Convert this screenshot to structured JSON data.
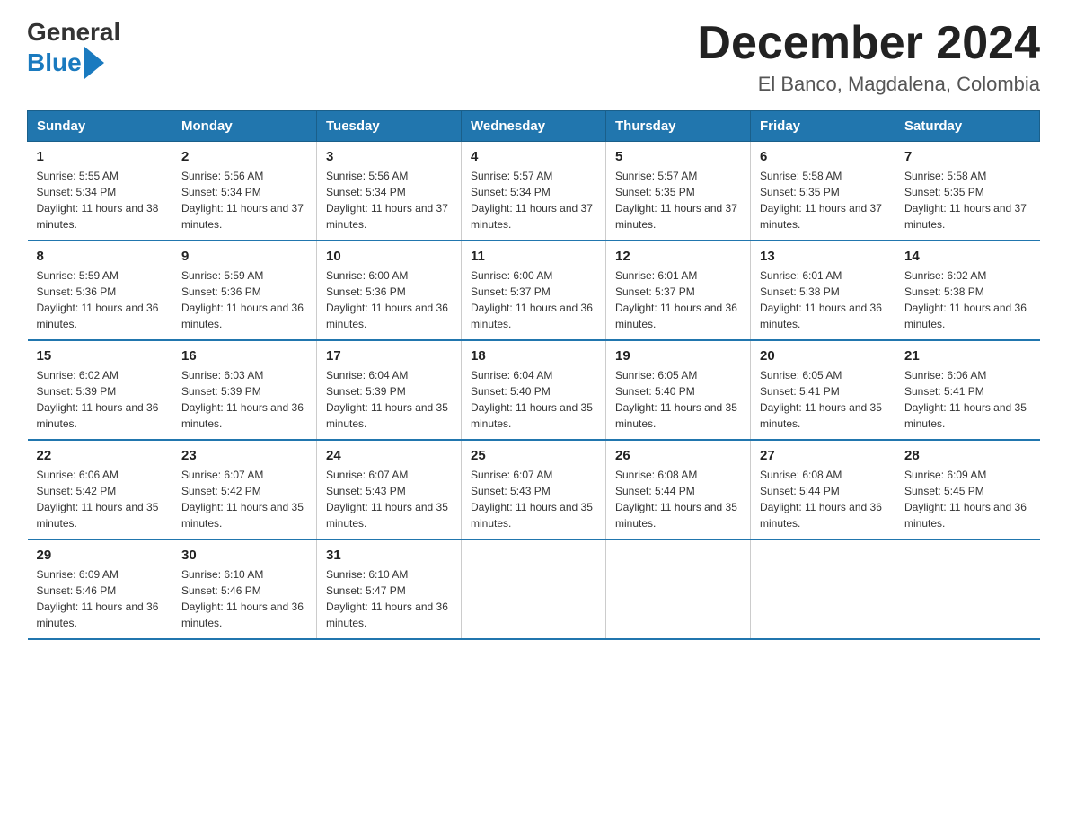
{
  "logo": {
    "general": "General",
    "blue": "Blue"
  },
  "header": {
    "month": "December 2024",
    "location": "El Banco, Magdalena, Colombia"
  },
  "days_header": [
    "Sunday",
    "Monday",
    "Tuesday",
    "Wednesday",
    "Thursday",
    "Friday",
    "Saturday"
  ],
  "weeks": [
    [
      {
        "day": "1",
        "sunrise": "Sunrise: 5:55 AM",
        "sunset": "Sunset: 5:34 PM",
        "daylight": "Daylight: 11 hours and 38 minutes."
      },
      {
        "day": "2",
        "sunrise": "Sunrise: 5:56 AM",
        "sunset": "Sunset: 5:34 PM",
        "daylight": "Daylight: 11 hours and 37 minutes."
      },
      {
        "day": "3",
        "sunrise": "Sunrise: 5:56 AM",
        "sunset": "Sunset: 5:34 PM",
        "daylight": "Daylight: 11 hours and 37 minutes."
      },
      {
        "day": "4",
        "sunrise": "Sunrise: 5:57 AM",
        "sunset": "Sunset: 5:34 PM",
        "daylight": "Daylight: 11 hours and 37 minutes."
      },
      {
        "day": "5",
        "sunrise": "Sunrise: 5:57 AM",
        "sunset": "Sunset: 5:35 PM",
        "daylight": "Daylight: 11 hours and 37 minutes."
      },
      {
        "day": "6",
        "sunrise": "Sunrise: 5:58 AM",
        "sunset": "Sunset: 5:35 PM",
        "daylight": "Daylight: 11 hours and 37 minutes."
      },
      {
        "day": "7",
        "sunrise": "Sunrise: 5:58 AM",
        "sunset": "Sunset: 5:35 PM",
        "daylight": "Daylight: 11 hours and 37 minutes."
      }
    ],
    [
      {
        "day": "8",
        "sunrise": "Sunrise: 5:59 AM",
        "sunset": "Sunset: 5:36 PM",
        "daylight": "Daylight: 11 hours and 36 minutes."
      },
      {
        "day": "9",
        "sunrise": "Sunrise: 5:59 AM",
        "sunset": "Sunset: 5:36 PM",
        "daylight": "Daylight: 11 hours and 36 minutes."
      },
      {
        "day": "10",
        "sunrise": "Sunrise: 6:00 AM",
        "sunset": "Sunset: 5:36 PM",
        "daylight": "Daylight: 11 hours and 36 minutes."
      },
      {
        "day": "11",
        "sunrise": "Sunrise: 6:00 AM",
        "sunset": "Sunset: 5:37 PM",
        "daylight": "Daylight: 11 hours and 36 minutes."
      },
      {
        "day": "12",
        "sunrise": "Sunrise: 6:01 AM",
        "sunset": "Sunset: 5:37 PM",
        "daylight": "Daylight: 11 hours and 36 minutes."
      },
      {
        "day": "13",
        "sunrise": "Sunrise: 6:01 AM",
        "sunset": "Sunset: 5:38 PM",
        "daylight": "Daylight: 11 hours and 36 minutes."
      },
      {
        "day": "14",
        "sunrise": "Sunrise: 6:02 AM",
        "sunset": "Sunset: 5:38 PM",
        "daylight": "Daylight: 11 hours and 36 minutes."
      }
    ],
    [
      {
        "day": "15",
        "sunrise": "Sunrise: 6:02 AM",
        "sunset": "Sunset: 5:39 PM",
        "daylight": "Daylight: 11 hours and 36 minutes."
      },
      {
        "day": "16",
        "sunrise": "Sunrise: 6:03 AM",
        "sunset": "Sunset: 5:39 PM",
        "daylight": "Daylight: 11 hours and 36 minutes."
      },
      {
        "day": "17",
        "sunrise": "Sunrise: 6:04 AM",
        "sunset": "Sunset: 5:39 PM",
        "daylight": "Daylight: 11 hours and 35 minutes."
      },
      {
        "day": "18",
        "sunrise": "Sunrise: 6:04 AM",
        "sunset": "Sunset: 5:40 PM",
        "daylight": "Daylight: 11 hours and 35 minutes."
      },
      {
        "day": "19",
        "sunrise": "Sunrise: 6:05 AM",
        "sunset": "Sunset: 5:40 PM",
        "daylight": "Daylight: 11 hours and 35 minutes."
      },
      {
        "day": "20",
        "sunrise": "Sunrise: 6:05 AM",
        "sunset": "Sunset: 5:41 PM",
        "daylight": "Daylight: 11 hours and 35 minutes."
      },
      {
        "day": "21",
        "sunrise": "Sunrise: 6:06 AM",
        "sunset": "Sunset: 5:41 PM",
        "daylight": "Daylight: 11 hours and 35 minutes."
      }
    ],
    [
      {
        "day": "22",
        "sunrise": "Sunrise: 6:06 AM",
        "sunset": "Sunset: 5:42 PM",
        "daylight": "Daylight: 11 hours and 35 minutes."
      },
      {
        "day": "23",
        "sunrise": "Sunrise: 6:07 AM",
        "sunset": "Sunset: 5:42 PM",
        "daylight": "Daylight: 11 hours and 35 minutes."
      },
      {
        "day": "24",
        "sunrise": "Sunrise: 6:07 AM",
        "sunset": "Sunset: 5:43 PM",
        "daylight": "Daylight: 11 hours and 35 minutes."
      },
      {
        "day": "25",
        "sunrise": "Sunrise: 6:07 AM",
        "sunset": "Sunset: 5:43 PM",
        "daylight": "Daylight: 11 hours and 35 minutes."
      },
      {
        "day": "26",
        "sunrise": "Sunrise: 6:08 AM",
        "sunset": "Sunset: 5:44 PM",
        "daylight": "Daylight: 11 hours and 35 minutes."
      },
      {
        "day": "27",
        "sunrise": "Sunrise: 6:08 AM",
        "sunset": "Sunset: 5:44 PM",
        "daylight": "Daylight: 11 hours and 36 minutes."
      },
      {
        "day": "28",
        "sunrise": "Sunrise: 6:09 AM",
        "sunset": "Sunset: 5:45 PM",
        "daylight": "Daylight: 11 hours and 36 minutes."
      }
    ],
    [
      {
        "day": "29",
        "sunrise": "Sunrise: 6:09 AM",
        "sunset": "Sunset: 5:46 PM",
        "daylight": "Daylight: 11 hours and 36 minutes."
      },
      {
        "day": "30",
        "sunrise": "Sunrise: 6:10 AM",
        "sunset": "Sunset: 5:46 PM",
        "daylight": "Daylight: 11 hours and 36 minutes."
      },
      {
        "day": "31",
        "sunrise": "Sunrise: 6:10 AM",
        "sunset": "Sunset: 5:47 PM",
        "daylight": "Daylight: 11 hours and 36 minutes."
      },
      null,
      null,
      null,
      null
    ]
  ]
}
